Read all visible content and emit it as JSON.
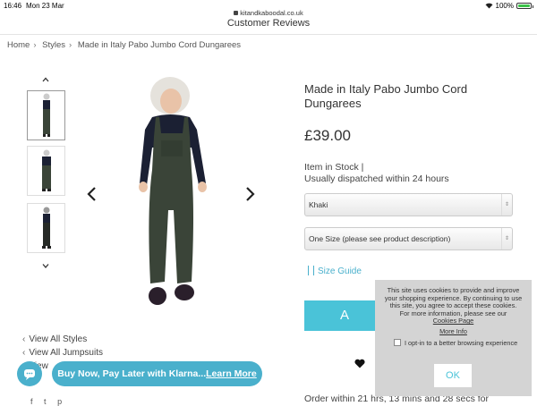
{
  "status_bar": {
    "time": "16:46",
    "date": "Mon 23 Mar",
    "url": "kitandkaboodal.co.uk",
    "battery": "100%",
    "battery_level": 1.0,
    "battery_color": "#3cc34a"
  },
  "header": {
    "title": "Customer Reviews"
  },
  "breadcrumb": [
    "Home",
    "Styles",
    "Made in Italy Pabo Jumbo Cord Dungarees"
  ],
  "gallery": {
    "thumbnail_count": 3,
    "selected": 0
  },
  "side_links": [
    "View All Styles",
    "View All Jumpsuits",
    "View"
  ],
  "klarna": {
    "prefix": "Buy Now, Pay Later with Klarna...",
    "link": "Learn More"
  },
  "product": {
    "title": "Made in Italy Pabo Jumbo Cord Dungarees",
    "price": "£39.00",
    "stock_line1": "Item in Stock |",
    "stock_line2": "Usually dispatched within 24 hours",
    "colour": "Khaki",
    "size": "One Size (please see product description)",
    "size_guide": "Size Guide",
    "add_button": "A",
    "order_text": "Order within 21 hrs, 13 mins and 28 secs for"
  },
  "cookie": {
    "message": "This site uses cookies to provide and improve your shopping experience. By continuing to use this site, you agree to accept these cookies.",
    "info": "For more information, please see our",
    "page_link": "Cookies Page",
    "more_info": "More Info",
    "optin": "I opt-in to a better browsing experience",
    "ok": "OK"
  },
  "colors": {
    "accent": "#4ab0cc",
    "button": "#4ac3d8",
    "cookie_bg": "#d4d4d4"
  },
  "icons": [
    "lock-icon",
    "wifi-icon",
    "battery-icon",
    "chevron-up-icon",
    "chevron-down-icon",
    "arrow-left-icon",
    "arrow-right-icon",
    "chat-icon",
    "heart-icon",
    "ruler-icon"
  ]
}
